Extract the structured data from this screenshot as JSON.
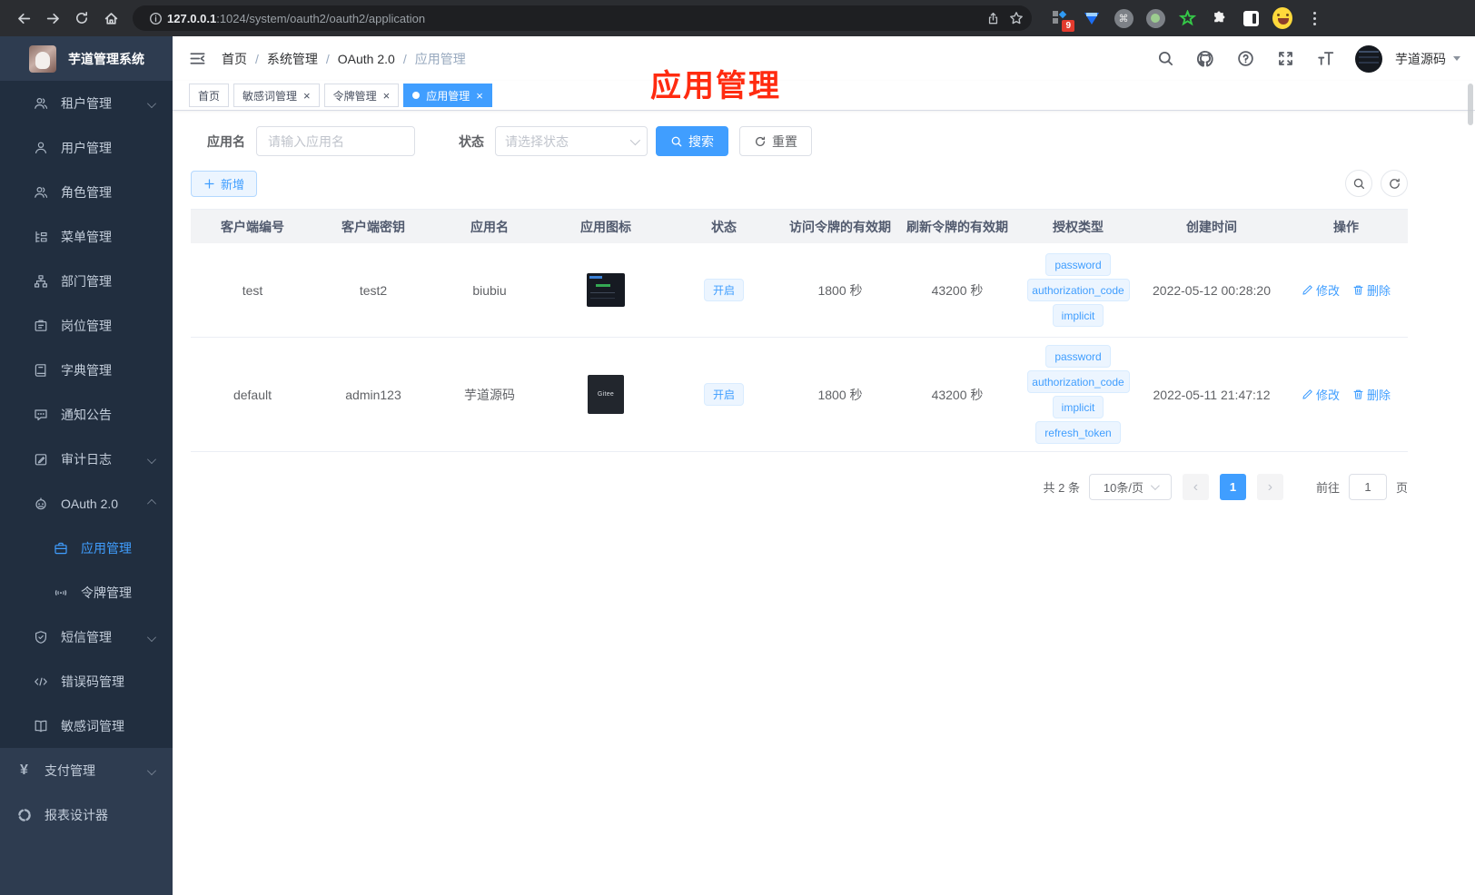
{
  "browser": {
    "url_host": "127.0.0.1",
    "url_path": ":1024/system/oauth2/oauth2/application",
    "extension_badge": "9"
  },
  "sidebar": {
    "title": "芋道管理系统",
    "items": [
      {
        "label": "租户管理"
      },
      {
        "label": "用户管理"
      },
      {
        "label": "角色管理"
      },
      {
        "label": "菜单管理"
      },
      {
        "label": "部门管理"
      },
      {
        "label": "岗位管理"
      },
      {
        "label": "字典管理"
      },
      {
        "label": "通知公告"
      },
      {
        "label": "审计日志"
      },
      {
        "label": "OAuth 2.0"
      },
      {
        "label": "应用管理"
      },
      {
        "label": "令牌管理"
      },
      {
        "label": "短信管理"
      },
      {
        "label": "错误码管理"
      },
      {
        "label": "敏感词管理"
      },
      {
        "label": "支付管理"
      },
      {
        "label": "报表设计器"
      }
    ],
    "pay_icon_glyph": "¥"
  },
  "navbar": {
    "crumbs": [
      "首页",
      "系统管理",
      "OAuth 2.0",
      "应用管理"
    ],
    "username": "芋道源码"
  },
  "tabs": [
    {
      "label": "首页"
    },
    {
      "label": "敏感词管理"
    },
    {
      "label": "令牌管理"
    },
    {
      "label": "应用管理"
    }
  ],
  "annotation": "应用管理",
  "filter": {
    "name_label": "应用名",
    "name_placeholder": "请输入应用名",
    "status_label": "状态",
    "status_placeholder": "请选择状态",
    "search_label": "搜索",
    "reset_label": "重置",
    "add_label": "新增"
  },
  "table": {
    "headers": [
      "客户端编号",
      "客户端密钥",
      "应用名",
      "应用图标",
      "状态",
      "访问令牌的有效期",
      "刷新令牌的有效期",
      "授权类型",
      "创建时间",
      "操作"
    ],
    "edit_label": "修改",
    "delete_label": "删除",
    "rows": [
      {
        "client_id": "test",
        "secret": "test2",
        "name": "biubiu",
        "status": "开启",
        "access_validity": "1800 秒",
        "refresh_validity": "43200 秒",
        "grants": [
          "password",
          "authorization_code",
          "implicit"
        ],
        "created": "2022-05-12 00:28:20"
      },
      {
        "client_id": "default",
        "secret": "admin123",
        "name": "芋道源码",
        "icon_text": "Gitee",
        "status": "开启",
        "access_validity": "1800 秒",
        "refresh_validity": "43200 秒",
        "grants": [
          "password",
          "authorization_code",
          "implicit",
          "refresh_token"
        ],
        "created": "2022-05-11 21:47:12"
      }
    ]
  },
  "pagination": {
    "total": "共 2 条",
    "page_size": "10条/页",
    "current_page": "1",
    "goto_label": "前往",
    "goto_value": "1",
    "page_unit": "页"
  },
  "colors": {
    "accent": "#409eff",
    "annotation_red": "#ff2b10",
    "sidebar_bg": "#2e3c50",
    "submenu_bg": "#212e3f"
  }
}
